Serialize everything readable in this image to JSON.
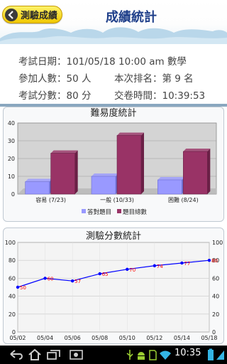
{
  "header": {
    "back_label": "測驗成績",
    "title": "成績統計"
  },
  "info": {
    "date_label": "考試日期：",
    "date_value": "101/05/18 10:00 am 數學",
    "participants_label": "參加人數：",
    "participants_value": "50 人",
    "rank_label": "本次排名：",
    "rank_value": "第 9 名",
    "score_label": "考試分數：",
    "score_value": "80 分",
    "submit_label": "交卷時間：",
    "submit_value": "10:39:53"
  },
  "colors": {
    "title": "#1f3f8a",
    "back_button": "#f5d000",
    "bar_correct": "#9999ff",
    "bar_total": "#993366",
    "line": "#0000ff",
    "point_label": "#ff0000"
  },
  "chart_data": [
    {
      "type": "bar",
      "title": "難易度統計",
      "categories": [
        "容易 (7/23)",
        "一般 (10/33)",
        "困難 (8/24)"
      ],
      "series": [
        {
          "name": "答對題目",
          "values": [
            7,
            10,
            8
          ]
        },
        {
          "name": "題目總數",
          "values": [
            23,
            33,
            24
          ]
        }
      ],
      "ylim": [
        0,
        40
      ],
      "yticks": [
        0,
        10,
        20,
        30,
        40
      ],
      "grid": true,
      "legend": "bottom"
    },
    {
      "type": "line",
      "title": "測驗分數統計",
      "x": [
        "05/02",
        "05/04",
        "05/06",
        "05/08",
        "05/10",
        "05/12",
        "05/14",
        "05/18"
      ],
      "series": [
        {
          "values": [
            50,
            60,
            57,
            65,
            70,
            74,
            77,
            80
          ]
        }
      ],
      "xticks": [
        "05/02",
        "05/04",
        "05/06",
        "05/08",
        "05/10",
        "05/12",
        "05/14",
        "05/18"
      ],
      "ylim": [
        0,
        100
      ],
      "yticks": [
        0,
        20,
        40,
        60,
        80,
        100
      ],
      "grid": true
    }
  ],
  "statusbar": {
    "clock": "10:35",
    "icons": [
      "back-icon",
      "home-icon",
      "recent-apps-icon",
      "screenshot-icon",
      "usb-icon",
      "android-debug-icon",
      "sd-card-icon",
      "wifi-icon",
      "battery-icon"
    ]
  }
}
